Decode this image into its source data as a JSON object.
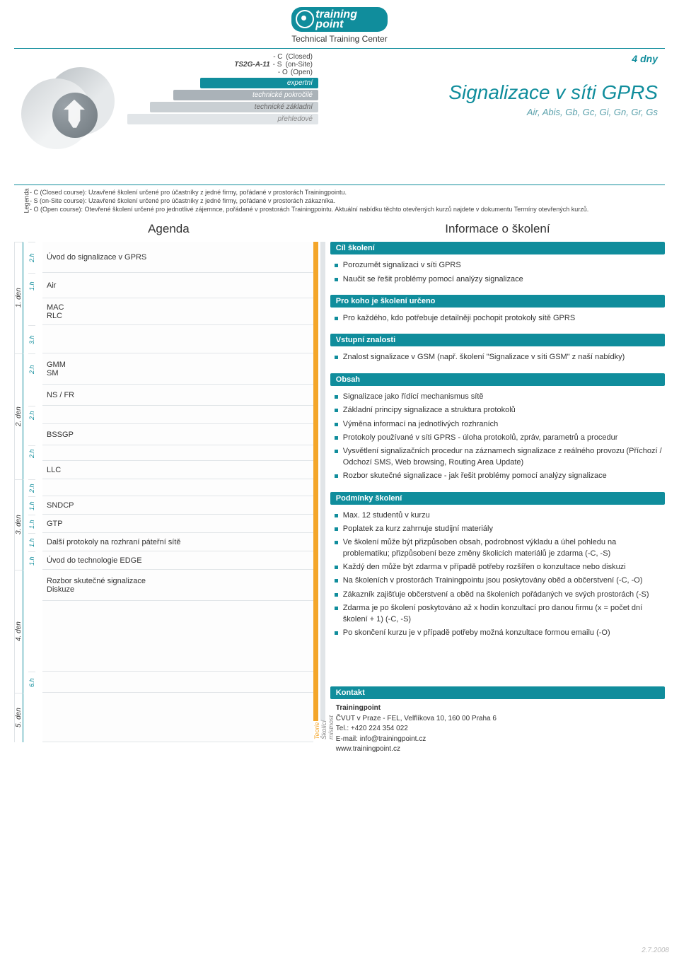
{
  "logo": {
    "line1": "training",
    "line2": "point",
    "subtitle": "Technical Training Center"
  },
  "course": {
    "code": "TS2G-A-11",
    "codes": [
      {
        "c": "- C",
        "l": "(Closed)"
      },
      {
        "c": "- S",
        "l": "(on-Site)"
      },
      {
        "c": "- O",
        "l": "(Open)"
      }
    ],
    "levels": {
      "l1": "expertní",
      "l2": "technické pokročilé",
      "l3": "technické základní",
      "l4": "přehledové"
    },
    "days": "4 dny",
    "title": "Signalizace v síti GPRS",
    "subtitle": "Air, Abis, Gb, Gc, Gi, Gn, Gr, Gs"
  },
  "legend": {
    "label": "Legenda",
    "lines": [
      "- C (Closed course): Uzavřené školení určené pro účastníky z jedné firmy, pořádané v prostorách Trainingpointu.",
      "- S (on-Site course): Uzavřené školení určené pro účastníky z jedné firmy, pořádané v prostorách zákazníka.",
      "- O (Open course): Otevřené školení určené pro jednotlivé zájemnce, pořádané v prostorách Trainingpointu. Aktuální nabídku těchto otevřených kurzů najdete v dokumentu Termíny otevřených kurzů."
    ]
  },
  "agenda": {
    "title": "Agenda",
    "bar_teo": "Teorie",
    "bar_sko": "Školící místnost",
    "days": [
      {
        "label": "1. den",
        "rows": [
          {
            "h": "2.h",
            "t": [
              "Úvod do signalizace v GPRS"
            ],
            "hh": 44
          },
          {
            "h": "1.h",
            "t": [
              "Air"
            ],
            "hh": 36
          },
          {
            "h": "",
            "t": [
              "MAC",
              "RLC"
            ],
            "hh": 38
          },
          {
            "h": "3.h",
            "t": [
              ""
            ],
            "hh": 40
          }
        ]
      },
      {
        "label": "2. den",
        "rows": [
          {
            "h": "2.h",
            "t": [
              "GMM",
              "SM"
            ],
            "hh": 44
          },
          {
            "h": "",
            "t": [
              "NS / FR"
            ],
            "hh": 30
          },
          {
            "h": "2.h",
            "t": [
              ""
            ],
            "hh": 26
          },
          {
            "h": "",
            "t": [
              "BSSGP"
            ],
            "hh": 30
          },
          {
            "h": "2.h",
            "t": [
              ""
            ],
            "hh": 22
          },
          {
            "h": "",
            "t": [
              "LLC"
            ],
            "hh": 26
          }
        ]
      },
      {
        "label": "3. den",
        "rows": [
          {
            "h": "2.h",
            "t": [
              ""
            ],
            "hh": 24
          },
          {
            "h": "1.h",
            "t": [
              "SNDCP"
            ],
            "hh": 26
          },
          {
            "h": "1.h",
            "t": [
              "GTP"
            ],
            "hh": 26
          },
          {
            "h": "1.h",
            "t": [
              "Další protokoly na rozhraní páteřní sítě"
            ],
            "hh": 26
          },
          {
            "h": "1.h",
            "t": [
              "Úvod do technologie EDGE"
            ],
            "hh": 26
          }
        ]
      },
      {
        "label": "4. den",
        "rows": [
          {
            "h": "",
            "t": [
              "Rozbor skutečné signalizace",
              "Diskuze"
            ],
            "hh": 44
          },
          {
            "h": "",
            "t": [
              ""
            ],
            "hh": 100
          },
          {
            "h": "6.h",
            "t": [
              ""
            ],
            "hh": 30
          }
        ]
      },
      {
        "label": "5. den",
        "rows": [
          {
            "h": "",
            "t": [
              ""
            ],
            "hh": 70
          }
        ]
      }
    ]
  },
  "info": {
    "title": "Informace o školení",
    "sections": [
      {
        "h": "Cíl školení",
        "items": [
          "Porozumět signalizaci v síti GPRS",
          "Naučit se řešit problémy pomocí analýzy signalizace"
        ]
      },
      {
        "h": "Pro koho je školení určeno",
        "items": [
          "Pro každého, kdo potřebuje detailněji pochopit protokoly sítě GPRS"
        ]
      },
      {
        "h": "Vstupní znalosti",
        "items": [
          "Znalost signalizace v GSM (např. školení \"Signalizace v síti GSM\" z naší nabídky)"
        ]
      },
      {
        "h": "Obsah",
        "items": [
          "Signalizace jako řídící mechanismus sítě",
          "Základní principy signalizace a struktura protokolů",
          "Výměna informací na jednotlivých rozhraních",
          "Protokoly používané v síti GPRS - úloha protokolů, zpráv, parametrů a procedur",
          "Vysvětlení signalizačních procedur na záznamech signalizace z reálného provozu (Příchozí / Odchozí SMS, Web browsing, Routing Area Update)",
          "Rozbor skutečné signalizace - jak řešit problémy pomocí analýzy signalizace"
        ]
      },
      {
        "h": "Podmínky školení",
        "items": [
          "Max. 12 studentů v kurzu",
          "Poplatek za kurz zahrnuje studijní materiály",
          "Ve školení může být přizpůsoben obsah, podrobnost výkladu a úhel pohledu na problematiku; přizpůsobení beze změny školicích materiálů je zdarma (-C, -S)",
          "Každý den může být zdarma v případě potřeby rozšířen o konzultace nebo diskuzi",
          "Na školeních v prostorách Trainingpointu jsou poskytovány oběd a občerstvení (-C, -O)",
          "Zákazník zajišťuje občerstvení a oběd na školeních pořádaných ve svých prostorách (-S)",
          "Zdarma je po školení poskytováno až x hodin konzultací pro danou firmu (x = počet dní školení + 1) (-C, -S)",
          "Po skončení kurzu je v případě potřeby možná konzultace formou emailu (-O)"
        ]
      }
    ]
  },
  "kontakt": {
    "h": "Kontakt",
    "name": "Trainingpoint",
    "addr": "ČVUT v Praze - FEL, Velflíkova 10, 160 00  Praha 6",
    "tel": "Tel.: +420 224 354 022",
    "mail": "E-mail: info@trainingpoint.cz",
    "web": "www.trainingpoint.cz"
  },
  "page_date": "2.7.2008"
}
